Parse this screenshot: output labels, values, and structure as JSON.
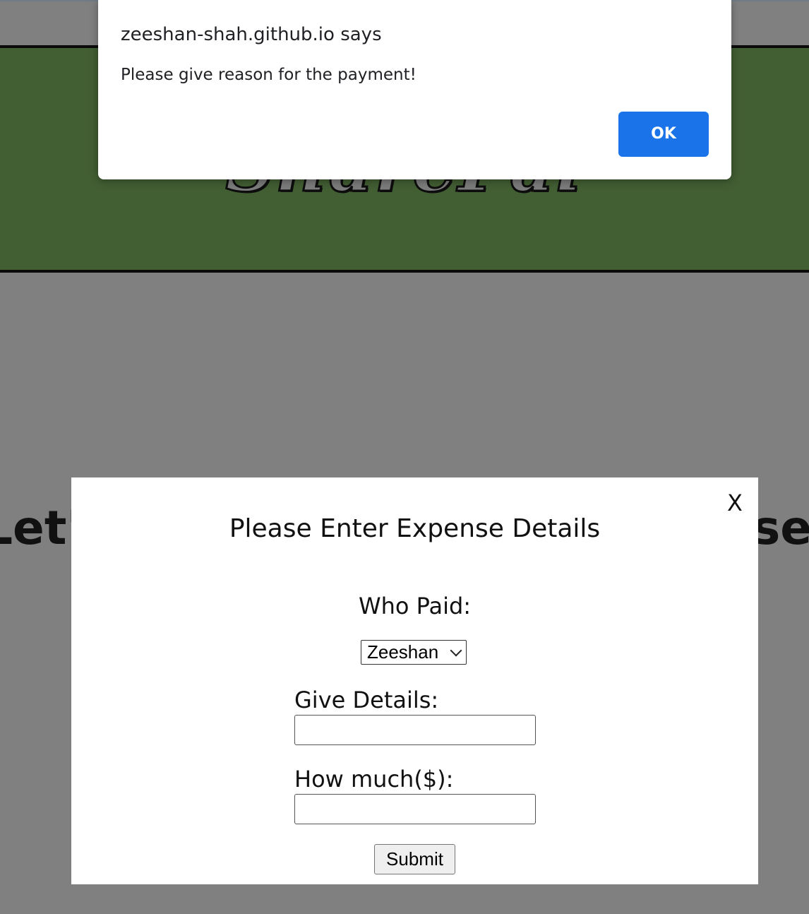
{
  "header": {
    "logo_text": "SharePal",
    "background_color": "#425e33"
  },
  "background": {
    "heading_left_fragment": "Let'",
    "heading_right_fragment": "ses"
  },
  "expense_modal": {
    "close_label": "X",
    "title": "Please Enter Expense Details",
    "who_paid_label": "Who Paid:",
    "who_paid_selected": "Zeeshan",
    "details_label": "Give Details:",
    "details_value": "",
    "amount_label": "How much($):",
    "amount_value": "",
    "submit_label": "Submit"
  },
  "alert_dialog": {
    "origin": "zeeshan-shah.github.io says",
    "message": "Please give reason for the payment!",
    "ok_label": "OK",
    "ok_color": "#1a73e8"
  }
}
